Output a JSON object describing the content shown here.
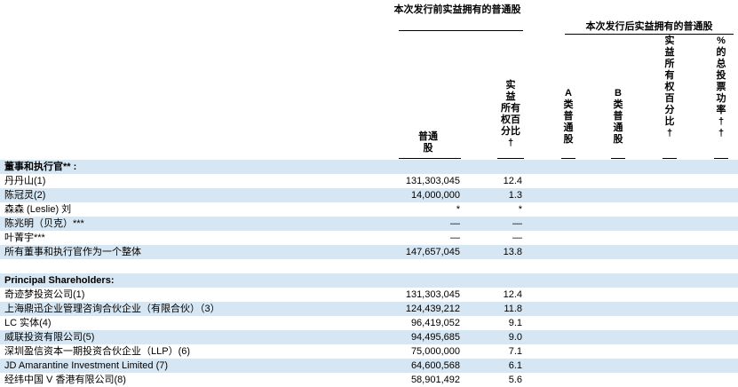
{
  "header": {
    "group_before": "本次发行前实益拥有的普通股",
    "group_after": "本次发行后实益拥有的普通股",
    "col_shares": "普通\n股",
    "col_pct_before": "实\n益\n所有\n权百\n分比\n†",
    "col_class_a": "A\n类\n普\n通\n股",
    "col_class_b": "B\n类\n普\n通\n股",
    "col_pct_after": "实\n益\n所\n有\n权\n百\n分\n比\n†",
    "col_voting": "%\n的\n总\n投\n票\n功\n率\n†\n†"
  },
  "rows": [
    {
      "label": "董事和执行官** :",
      "shares": "",
      "pct": "",
      "section": true
    },
    {
      "label": "丹丹山(1)",
      "shares": "131,303,045",
      "pct": "12.4"
    },
    {
      "label": "陈冠灵(2)",
      "shares": "14,000,000",
      "pct": "1.3"
    },
    {
      "label": "森森 (Leslie) 刘",
      "shares": "*",
      "pct": "*"
    },
    {
      "label": "陈兆明（贝克）***",
      "shares": "—",
      "pct": "—"
    },
    {
      "label": "叶菁宇***",
      "shares": "—",
      "pct": "—"
    },
    {
      "label": "所有董事和执行官作为一个整体",
      "shares": "147,657,045",
      "pct": "13.8"
    },
    {
      "label": "",
      "shares": "",
      "pct": ""
    },
    {
      "label": "Principal Shareholders:",
      "shares": "",
      "pct": "",
      "section": true
    },
    {
      "label": "奇迹梦投资公司(1)",
      "shares": "131,303,045",
      "pct": "12.4"
    },
    {
      "label": "上海鼎迅企业管理咨询合伙企业（有限合伙）（3）",
      "shares": "124,439,212",
      "pct": "11.8"
    },
    {
      "label": "LC 实体(4)",
      "shares": "96,419,052",
      "pct": "9.1"
    },
    {
      "label": "威联投资有限公司(5)",
      "shares": "94,495,685",
      "pct": "9.0"
    },
    {
      "label": "深圳盈信资本一期投资合伙企业（LLP）(6)",
      "shares": "75,000,000",
      "pct": "7.1"
    },
    {
      "label": "JD Amarantine Investment Limited (7)",
      "shares": "64,600,568",
      "pct": "6.1"
    },
    {
      "label": "经纬中国 V 香港有限公司(8)",
      "shares": "58,901,492",
      "pct": "5.6"
    }
  ]
}
